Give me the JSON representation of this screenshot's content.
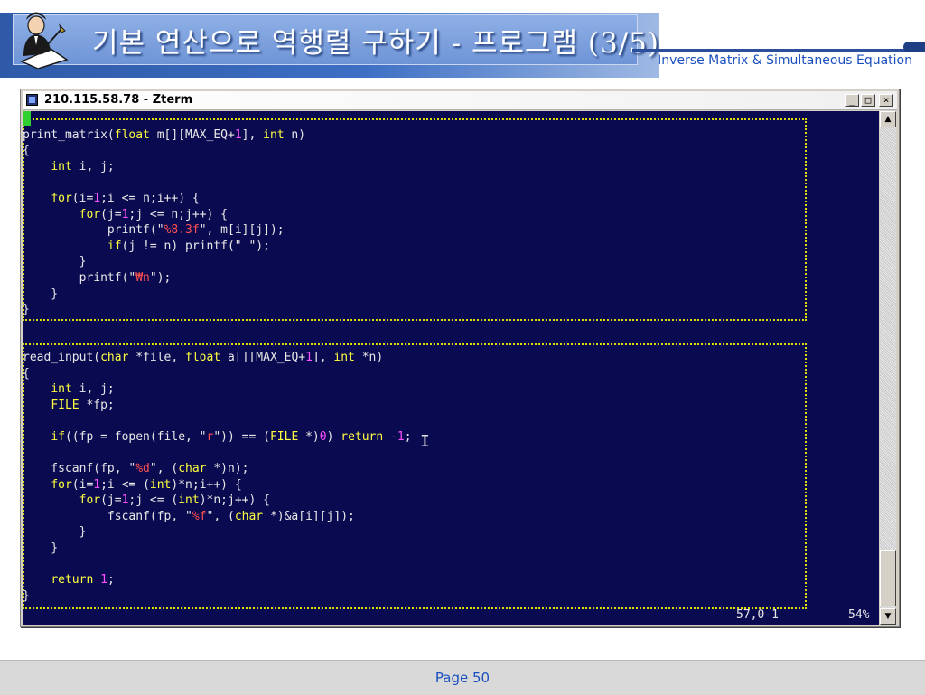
{
  "slide": {
    "title": "기본 연산으로 역행렬 구하기 - 프로그램 (3/5)",
    "subtitle": "Inverse Matrix & Simultaneous Equation",
    "page": "Page 50",
    "logo_icon": "scholar-writing-icon"
  },
  "window": {
    "title": "210.115.58.78 - Zterm",
    "buttons": {
      "minimize": "_",
      "maximize": "□",
      "close": "×"
    },
    "app_icon": "terminal-icon"
  },
  "terminal": {
    "colors": {
      "background": "#0a0a50",
      "text": "#e8e8e8",
      "keyword": "#ffff40",
      "number": "#ff50ff",
      "string": "#ff5050",
      "fold": "#e0e000",
      "cursor": "#30d030"
    },
    "lines": [
      [
        [
          " ",
          ""
        ]
      ],
      [
        [
          "print_matrix(",
          ""
        ],
        [
          "float",
          "kw"
        ],
        [
          " m[][MAX_EQ+",
          ""
        ],
        [
          "1",
          "num"
        ],
        [
          "], ",
          ""
        ],
        [
          "int",
          "kw"
        ],
        [
          " n)",
          ""
        ]
      ],
      [
        [
          "{",
          ""
        ]
      ],
      [
        [
          "    ",
          ""
        ],
        [
          "int",
          "kw"
        ],
        [
          " i, j;",
          ""
        ]
      ],
      [
        [
          "",
          ""
        ]
      ],
      [
        [
          "    ",
          ""
        ],
        [
          "for",
          "kw"
        ],
        [
          "(i=",
          ""
        ],
        [
          "1",
          "num"
        ],
        [
          ";i <= n;i++) {",
          ""
        ]
      ],
      [
        [
          "        ",
          ""
        ],
        [
          "for",
          "kw"
        ],
        [
          "(j=",
          ""
        ],
        [
          "1",
          "num"
        ],
        [
          ";j <= n;j++) {",
          ""
        ]
      ],
      [
        [
          "            printf(\"",
          ""
        ],
        [
          "%8.3f",
          "str"
        ],
        [
          "\", m[i][j]);",
          ""
        ]
      ],
      [
        [
          "            ",
          ""
        ],
        [
          "if",
          "kw"
        ],
        [
          "(j != n) printf(\"",
          ""
        ],
        [
          " ",
          "str"
        ],
        [
          "\");",
          ""
        ]
      ],
      [
        [
          "        }",
          ""
        ]
      ],
      [
        [
          "        printf(\"",
          ""
        ],
        [
          "₩n",
          "str"
        ],
        [
          "\");",
          ""
        ]
      ],
      [
        [
          "    }",
          ""
        ]
      ],
      [
        [
          "}",
          ""
        ]
      ],
      [
        [
          "",
          ""
        ]
      ],
      [
        [
          "",
          ""
        ]
      ],
      [
        [
          "read_input(",
          ""
        ],
        [
          "char",
          "kw"
        ],
        [
          " *file, ",
          ""
        ],
        [
          "float",
          "kw"
        ],
        [
          " a[][MAX_EQ+",
          ""
        ],
        [
          "1",
          "num"
        ],
        [
          "], ",
          ""
        ],
        [
          "int",
          "kw"
        ],
        [
          " *n)",
          ""
        ]
      ],
      [
        [
          "{",
          ""
        ]
      ],
      [
        [
          "    ",
          ""
        ],
        [
          "int",
          "kw"
        ],
        [
          " i, j;",
          ""
        ]
      ],
      [
        [
          "    ",
          ""
        ],
        [
          "FILE",
          "kw"
        ],
        [
          " *fp;",
          ""
        ]
      ],
      [
        [
          "",
          ""
        ]
      ],
      [
        [
          "    ",
          ""
        ],
        [
          "if",
          "kw"
        ],
        [
          "((fp = fopen(file, \"",
          ""
        ],
        [
          "r",
          "str"
        ],
        [
          "\")) == (",
          ""
        ],
        [
          "FILE",
          "kw"
        ],
        [
          " *)",
          ""
        ],
        [
          "0",
          "num"
        ],
        [
          ") ",
          ""
        ],
        [
          "return",
          "kw"
        ],
        [
          " -",
          ""
        ],
        [
          "1",
          "num"
        ],
        [
          ";",
          ""
        ]
      ],
      [
        [
          "",
          ""
        ]
      ],
      [
        [
          "    fscanf(fp, \"",
          ""
        ],
        [
          "%d",
          "str"
        ],
        [
          "\", (",
          ""
        ],
        [
          "char",
          "kw"
        ],
        [
          " *)n);",
          ""
        ]
      ],
      [
        [
          "    ",
          ""
        ],
        [
          "for",
          "kw"
        ],
        [
          "(i=",
          ""
        ],
        [
          "1",
          "num"
        ],
        [
          ";i <= (",
          ""
        ],
        [
          "int",
          "kw"
        ],
        [
          ")*n;i++) {",
          ""
        ]
      ],
      [
        [
          "        ",
          ""
        ],
        [
          "for",
          "kw"
        ],
        [
          "(j=",
          ""
        ],
        [
          "1",
          "num"
        ],
        [
          ";j <= (",
          ""
        ],
        [
          "int",
          "kw"
        ],
        [
          ")*n;j++) {",
          ""
        ]
      ],
      [
        [
          "            fscanf(fp, \"",
          ""
        ],
        [
          "%f",
          "str"
        ],
        [
          "\", (",
          ""
        ],
        [
          "char",
          "kw"
        ],
        [
          " *)&a[i][j]);",
          ""
        ]
      ],
      [
        [
          "        }",
          ""
        ]
      ],
      [
        [
          "    }",
          ""
        ]
      ],
      [
        [
          "",
          ""
        ]
      ],
      [
        [
          "    ",
          ""
        ],
        [
          "return",
          "kw"
        ],
        [
          " ",
          ""
        ],
        [
          "1",
          "num"
        ],
        [
          ";",
          ""
        ]
      ],
      [
        [
          "}",
          ""
        ]
      ]
    ],
    "status_position": "57,0-1",
    "status_percent": "54%"
  }
}
